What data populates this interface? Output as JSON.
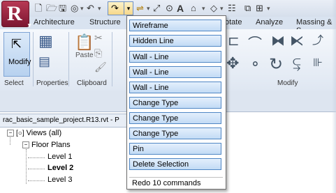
{
  "app": {
    "logo_letter": "R",
    "accent": "#a3243f"
  },
  "tabs": [
    "Architecture",
    "Structure",
    "otate",
    "Analyze",
    "Massing & S"
  ],
  "ribbon": {
    "modify_label": "Modify",
    "paste_label": "Paste",
    "panels": [
      "Select",
      "Properties",
      "Clipboard",
      "Modify"
    ]
  },
  "project_browser": {
    "title": "rac_basic_sample_project.R13.rvt - P",
    "tree": [
      {
        "label": "Views (all)",
        "toggle": "⊟",
        "bold": false
      },
      {
        "label": "Floor Plans",
        "toggle": "⊟",
        "bold": false
      },
      {
        "label": "Level 1",
        "bold": false
      },
      {
        "label": "Level 2",
        "bold": true
      },
      {
        "label": "Level 3",
        "bold": false
      }
    ]
  },
  "redo_menu": {
    "items": [
      "Wireframe",
      "Hidden Line",
      "Wall - Line",
      "Wall - Line",
      "Wall - Line",
      "Change Type",
      "Change Type",
      "Change Type",
      "Pin",
      "Delete Selection"
    ],
    "footer": "Redo 10 commands"
  },
  "icons": {
    "new": "new-file-icon",
    "open": "open-folder-icon",
    "save": "save-icon",
    "undo": "undo-icon",
    "redo": "redo-icon"
  }
}
